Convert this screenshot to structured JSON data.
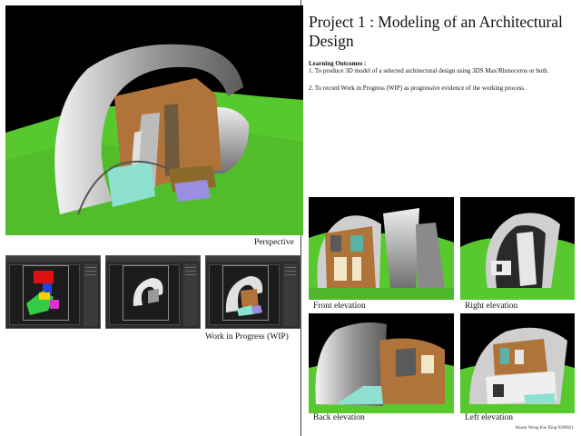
{
  "title": "Project 1 : Modeling of an Architectural Design",
  "learning_outcomes": {
    "heading": "Learning Outcomes :",
    "items": [
      "1. To produce 3D model of a selected architectural design using 3DS Max/Rhinoceros or both.",
      "2. To record Work in Progress (WIP) as progressive evidence of the working process."
    ]
  },
  "captions": {
    "perspective": "Perspective",
    "wip": "Work in Progress (WIP)",
    "front": "Front elevation",
    "right": "Right elevation",
    "back": "Back elevation",
    "left": "Left elevation"
  },
  "footer": "Alison Wong Kie Xing 0309021",
  "colors": {
    "grass": "#66dd33",
    "sky": "#000000",
    "shell": "#d8d8d8",
    "wood": "#b0733a",
    "viewport_bg": "#2b2b2b"
  }
}
